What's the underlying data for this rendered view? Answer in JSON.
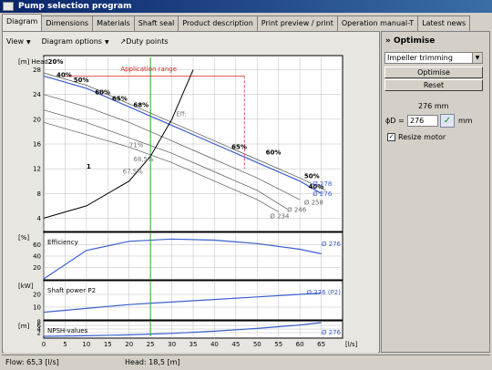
{
  "window": {
    "title": "Pump selection program"
  },
  "tabs": [
    "Diagram",
    "Dimensions",
    "Materials",
    "Shaft seal",
    "Product description",
    "Print preview / print",
    "Operation manual-T",
    "Latest news"
  ],
  "toolbar": {
    "view": "View",
    "diagram_options": "Diagram options",
    "duty_points": "Duty points"
  },
  "optimise": {
    "title": "Optimise",
    "method": "Impeller trimming",
    "optimise_button": "Optimise",
    "reset_button": "Reset",
    "diameter_readout": "276 mm",
    "diameter_label": "ϕD =",
    "diameter_value": "276",
    "diameter_unit": "mm",
    "resize_motor_label": "Resize motor",
    "resize_motor_checked": true
  },
  "status": {
    "flow": "Flow: 65,3 [l/s]",
    "head": "Head: 18,5 [m]"
  },
  "colors": {
    "curve_blue": "#3a5fcd",
    "application_range_red": "#e02020",
    "duty_point_green": "#2aa52a"
  },
  "chart_data": [
    {
      "type": "line",
      "title": "",
      "ylabel": "[m] Head",
      "xlabel": "[l/s]",
      "xlim": [
        0,
        70
      ],
      "ylim": [
        2,
        30
      ],
      "x_ticks": [
        0,
        5,
        10,
        15,
        20,
        25,
        30,
        35,
        40,
        45,
        50,
        55,
        60,
        65
      ],
      "y_ticks": [
        4,
        8,
        12,
        16,
        20,
        24,
        28
      ],
      "series": [
        {
          "name": "Ø 278",
          "x": [
            0,
            10,
            20,
            30,
            40,
            50,
            60,
            66
          ],
          "y": [
            27.5,
            25.5,
            22.5,
            19.5,
            16.5,
            13.5,
            10.5,
            8.5
          ]
        },
        {
          "name": "Ø 276",
          "x": [
            0,
            10,
            20,
            30,
            40,
            50,
            60,
            65
          ],
          "y": [
            27,
            25,
            22,
            19,
            16,
            13,
            10,
            8
          ]
        },
        {
          "name": "Ø 258",
          "x": [
            0,
            10,
            20,
            30,
            40,
            50,
            60
          ],
          "y": [
            24,
            22,
            19.5,
            16.5,
            13.5,
            10.5,
            7
          ]
        },
        {
          "name": "Ø 246",
          "x": [
            0,
            10,
            20,
            30,
            40,
            50,
            57
          ],
          "y": [
            21.5,
            19.5,
            17,
            14.5,
            11.5,
            8.5,
            5.5
          ]
        },
        {
          "name": "Ø 234",
          "x": [
            0,
            10,
            20,
            30,
            40,
            50,
            55
          ],
          "y": [
            19.5,
            17.5,
            15.5,
            13,
            10,
            7,
            5
          ]
        }
      ],
      "system_curve_label": "1",
      "application_range_label": "Application range",
      "application_range_x": [
        5,
        47
      ],
      "efficiency_labels": [
        "20%",
        "40%",
        "50%",
        "60%",
        "65%",
        "68%",
        "65%",
        "60%",
        "50%",
        "40%"
      ],
      "duty_point_labels": [
        "Eff:",
        "68,5%",
        "67,5%",
        "71%"
      ],
      "diameter_labels": [
        "Ø 278",
        "Ø 276",
        "Ø 258",
        "Ø 246",
        "Ø 234"
      ],
      "duty_x": 25
    },
    {
      "type": "line",
      "title": "Efficiency",
      "ylabel": "[%]",
      "ylim": [
        0,
        80
      ],
      "y_ticks": [
        20,
        40,
        60
      ],
      "series": [
        {
          "name": "Ø 276",
          "x": [
            0,
            10,
            20,
            30,
            40,
            50,
            60,
            65
          ],
          "y": [
            0,
            50,
            66,
            70,
            68,
            62,
            52,
            44
          ]
        }
      ],
      "curve_label": "Ø 276"
    },
    {
      "type": "line",
      "title": "Shaft power P2",
      "ylabel": "[kW]",
      "ylim": [
        0,
        30
      ],
      "y_ticks": [
        10,
        20
      ],
      "series": [
        {
          "name": "Ø 276 (P2)",
          "x": [
            0,
            10,
            20,
            30,
            40,
            50,
            60,
            65
          ],
          "y": [
            6,
            9,
            12,
            14,
            16,
            18,
            20,
            21
          ]
        }
      ],
      "curve_label": "Ø 276 (P2)"
    },
    {
      "type": "line",
      "title": "NPSH-values",
      "ylabel": "[m]",
      "ylim": [
        0,
        8
      ],
      "y_ticks": [
        2,
        4,
        6,
        8
      ],
      "series": [
        {
          "name": "Ø 276",
          "x": [
            0,
            10,
            20,
            30,
            40,
            50,
            60,
            65
          ],
          "y": [
            0,
            0.3,
            0.8,
            1.6,
            2.8,
            4.3,
            6.2,
            7.5
          ]
        }
      ],
      "curve_label": "Ø 276"
    }
  ]
}
